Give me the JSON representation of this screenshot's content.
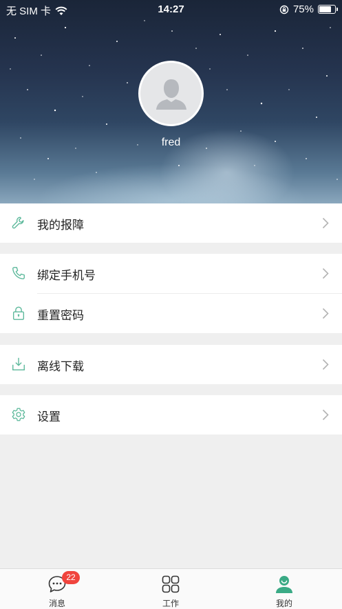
{
  "status_bar": {
    "carrier": "无 SIM 卡",
    "time": "14:27",
    "battery_text": "75%",
    "battery_level": 0.75
  },
  "profile": {
    "username": "fred"
  },
  "menu": {
    "groups": [
      [
        {
          "label": "我的报障",
          "icon": "wrench-icon"
        }
      ],
      [
        {
          "label": "绑定手机号",
          "icon": "phone-icon"
        },
        {
          "label": "重置密码",
          "icon": "lock-icon"
        }
      ],
      [
        {
          "label": "离线下载",
          "icon": "download-icon"
        }
      ],
      [
        {
          "label": "设置",
          "icon": "gear-icon"
        }
      ]
    ]
  },
  "tabbar": {
    "tabs": [
      {
        "label": "消息",
        "icon": "chat-bubble-icon",
        "badge": "22"
      },
      {
        "label": "工作",
        "icon": "grid-icon"
      },
      {
        "label": "我的",
        "icon": "person-icon",
        "active": true
      }
    ]
  },
  "colors": {
    "accent": "#3aaa85",
    "badge": "#f0443d",
    "icon_line": "#5bb89a"
  }
}
